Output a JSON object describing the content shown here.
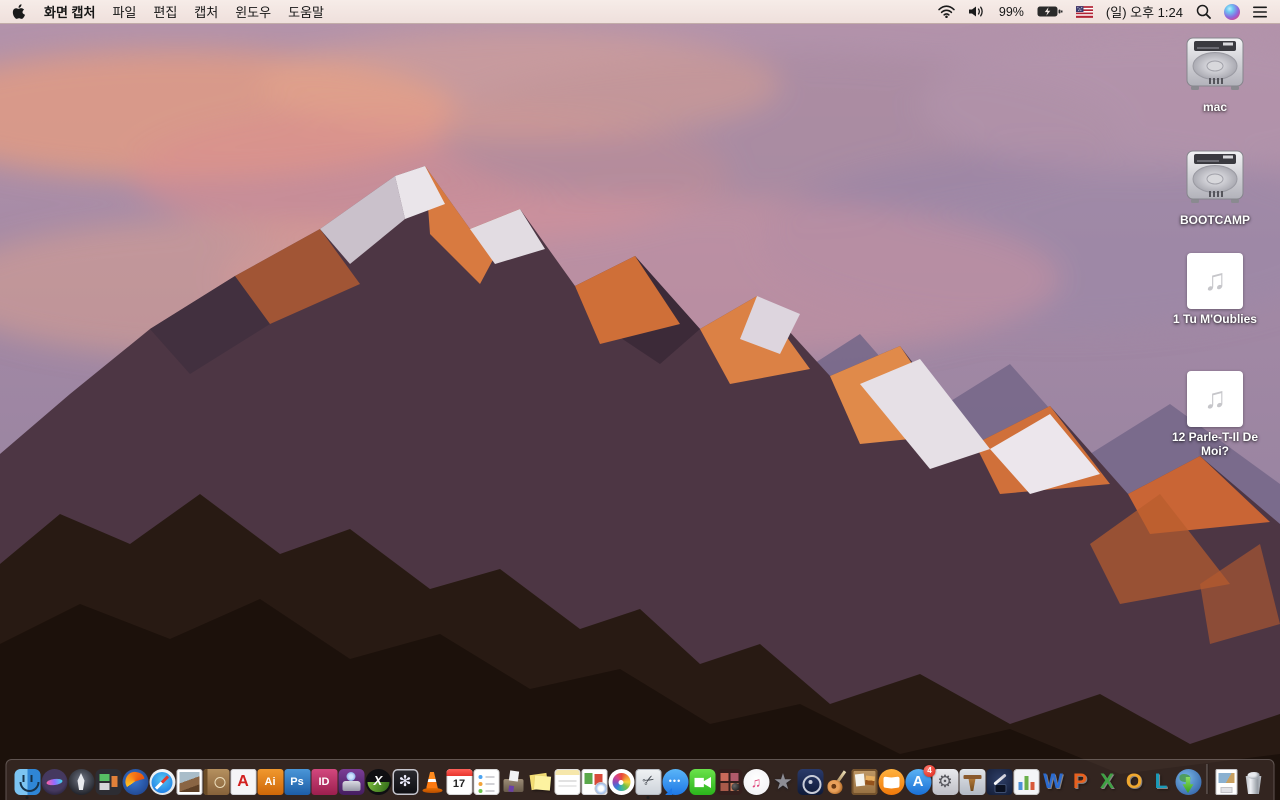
{
  "menu_bar": {
    "menus": [
      {
        "label": "화면 캡처",
        "bold": true
      },
      {
        "label": "파일"
      },
      {
        "label": "편집"
      },
      {
        "label": "캡처"
      },
      {
        "label": "윈도우"
      },
      {
        "label": "도움말"
      }
    ],
    "status": {
      "battery_percent": "99%",
      "clock": "(일) 오후 1:24",
      "icons": [
        "wifi-icon",
        "volume-icon",
        "battery-charging-icon",
        "us-flag-input-icon",
        "spotlight-search-icon",
        "siri-icon",
        "notification-center-icon"
      ]
    }
  },
  "desktop": {
    "icons": [
      {
        "label": "mac",
        "kind": "hard-drive"
      },
      {
        "label": "BOOTCAMP",
        "kind": "hard-drive"
      },
      {
        "label": "1 Tu M'Oublies",
        "kind": "audio-file"
      },
      {
        "label": "12 Parle-T-Il De Moi?",
        "kind": "audio-file"
      }
    ]
  },
  "dock": {
    "app_store_badge": "4",
    "apps": [
      {
        "id": "finder",
        "running": true
      },
      {
        "id": "siri"
      },
      {
        "id": "launchpad"
      },
      {
        "id": "mission-control"
      },
      {
        "id": "firefox"
      },
      {
        "id": "safari"
      },
      {
        "id": "preview"
      },
      {
        "id": "contacts"
      },
      {
        "id": "acrobat"
      },
      {
        "id": "illustrator"
      },
      {
        "id": "photoshop"
      },
      {
        "id": "indesign"
      },
      {
        "id": "toast"
      },
      {
        "id": "x-media"
      },
      {
        "id": "disk-fan"
      },
      {
        "id": "vlc"
      },
      {
        "id": "calendar"
      },
      {
        "id": "reminders"
      },
      {
        "id": "ballot-box"
      },
      {
        "id": "stickies"
      },
      {
        "id": "notes"
      },
      {
        "id": "docs-badge"
      },
      {
        "id": "photos"
      },
      {
        "id": "grab",
        "running": true
      },
      {
        "id": "messages"
      },
      {
        "id": "facetime"
      },
      {
        "id": "photo-booth"
      },
      {
        "id": "itunes"
      },
      {
        "id": "imovie"
      },
      {
        "id": "dvd-player"
      },
      {
        "id": "garageband"
      },
      {
        "id": "corkboard"
      },
      {
        "id": "ibooks"
      },
      {
        "id": "app-store",
        "badge": "4"
      },
      {
        "id": "system-preferences"
      },
      {
        "id": "keynote"
      },
      {
        "id": "pages-classic"
      },
      {
        "id": "numbers-classic"
      },
      {
        "id": "word"
      },
      {
        "id": "powerpoint"
      },
      {
        "id": "excel"
      },
      {
        "id": "outlook"
      },
      {
        "id": "lync"
      },
      {
        "id": "downloads"
      },
      {
        "id": "divider"
      },
      {
        "id": "image-document"
      },
      {
        "id": "trash"
      }
    ]
  },
  "colors": {
    "menu_bar_bg": "#f3e6e2",
    "dock_bg": "rgba(84,66,63,0.42)",
    "desktop_label": "#ffffff",
    "badge_red": "#d81e12"
  }
}
